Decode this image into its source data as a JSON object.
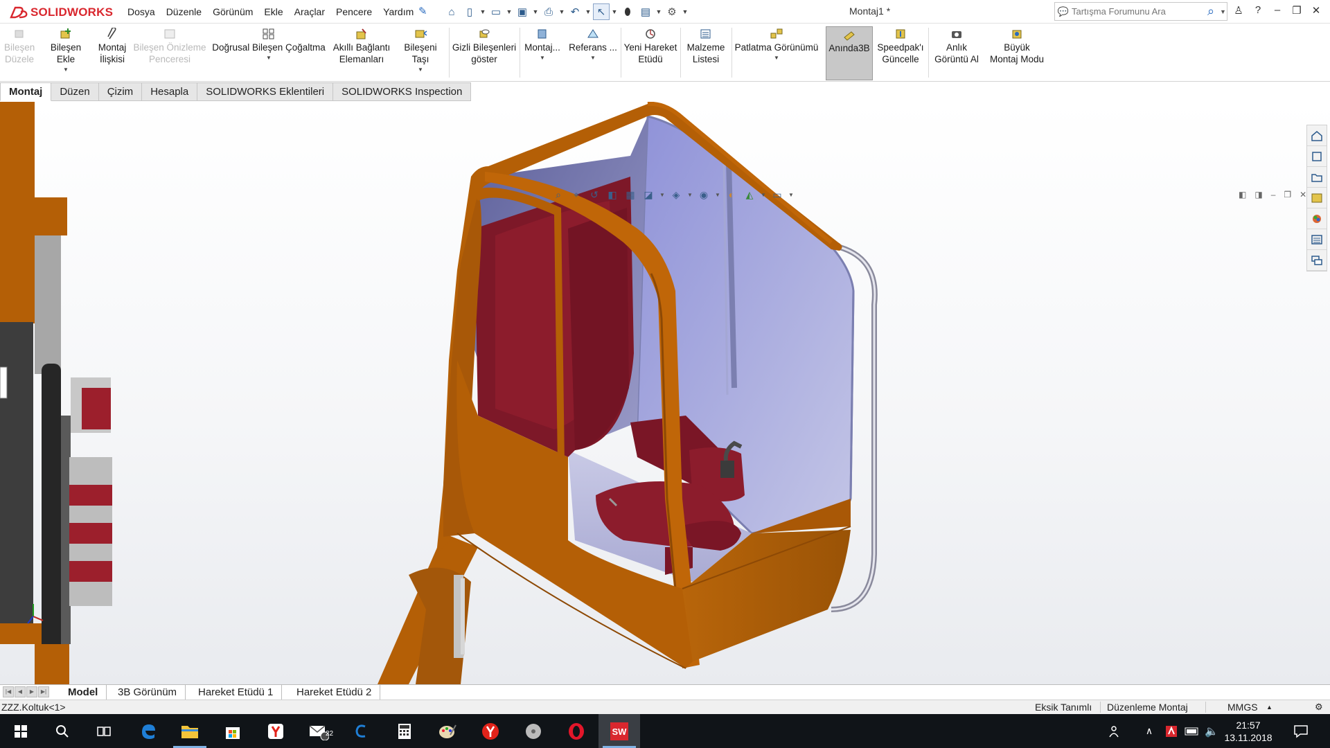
{
  "app": {
    "logo_text": "SOLIDWORKS",
    "document_title": "Montaj1 *"
  },
  "menu": [
    "Dosya",
    "Düzenle",
    "Görünüm",
    "Ekle",
    "Araçlar",
    "Pencere",
    "Yardım"
  ],
  "search": {
    "placeholder": "Tartışma Forumunu Ara"
  },
  "commands": [
    {
      "label1": "Bileşen",
      "label2": "Düzele",
      "disabled": true
    },
    {
      "label1": "Bileşen Ekle",
      "label2": "",
      "disabled": false
    },
    {
      "label1": "Montaj",
      "label2": "İlişkisi",
      "disabled": false
    },
    {
      "label1": "Bileşen Önizleme",
      "label2": "Penceresi",
      "disabled": true
    },
    {
      "label1": "Doğrusal Bileşen Çoğaltma",
      "label2": "",
      "disabled": false
    },
    {
      "label1": "Akıllı Bağlantı",
      "label2": "Elemanları",
      "disabled": false
    },
    {
      "label1": "Bileşeni Taşı",
      "label2": "",
      "disabled": false
    },
    {
      "label1": "Gizli Bileşenleri",
      "label2": "göster",
      "disabled": false
    },
    {
      "label1": "Montaj...",
      "label2": "",
      "disabled": false
    },
    {
      "label1": "Referans ...",
      "label2": "",
      "disabled": false
    },
    {
      "label1": "Yeni Hareket",
      "label2": "Etüdü",
      "disabled": false
    },
    {
      "label1": "Malzeme",
      "label2": "Listesi",
      "disabled": false
    },
    {
      "label1": "Patlatma Görünümü",
      "label2": "",
      "disabled": false
    },
    {
      "label1": "Anında3B",
      "label2": "",
      "disabled": false
    },
    {
      "label1": "Speedpak'ı",
      "label2": "Güncelle",
      "disabled": false
    },
    {
      "label1": "Anlık",
      "label2": "Görüntü Al",
      "disabled": false
    },
    {
      "label1": "Büyük",
      "label2": "Montaj Modu",
      "disabled": false
    }
  ],
  "tabs": [
    "Montaj",
    "Düzen",
    "Çizim",
    "Hesapla",
    "SOLIDWORKS Eklentileri",
    "SOLIDWORKS Inspection"
  ],
  "bottom_tabs": [
    "Model",
    "3B Görünüm",
    "Hareket Etüdü 1",
    "Hareket Etüdü 2"
  ],
  "status": {
    "left": "ZZZ.Koltuk<1>",
    "definition": "Eksik Tanımlı",
    "mode": "Düzenleme Montaj",
    "units": "MMGS"
  },
  "taskbar": {
    "mail_badge": "22",
    "time": "21:57",
    "date": "13.11.2018"
  },
  "colors": {
    "cab_orange": "#b45f06",
    "seat_red": "#8c1c2c",
    "glass": "#8a8fd0",
    "solidworks_red": "#d9272e",
    "taskbar": "#101418"
  }
}
